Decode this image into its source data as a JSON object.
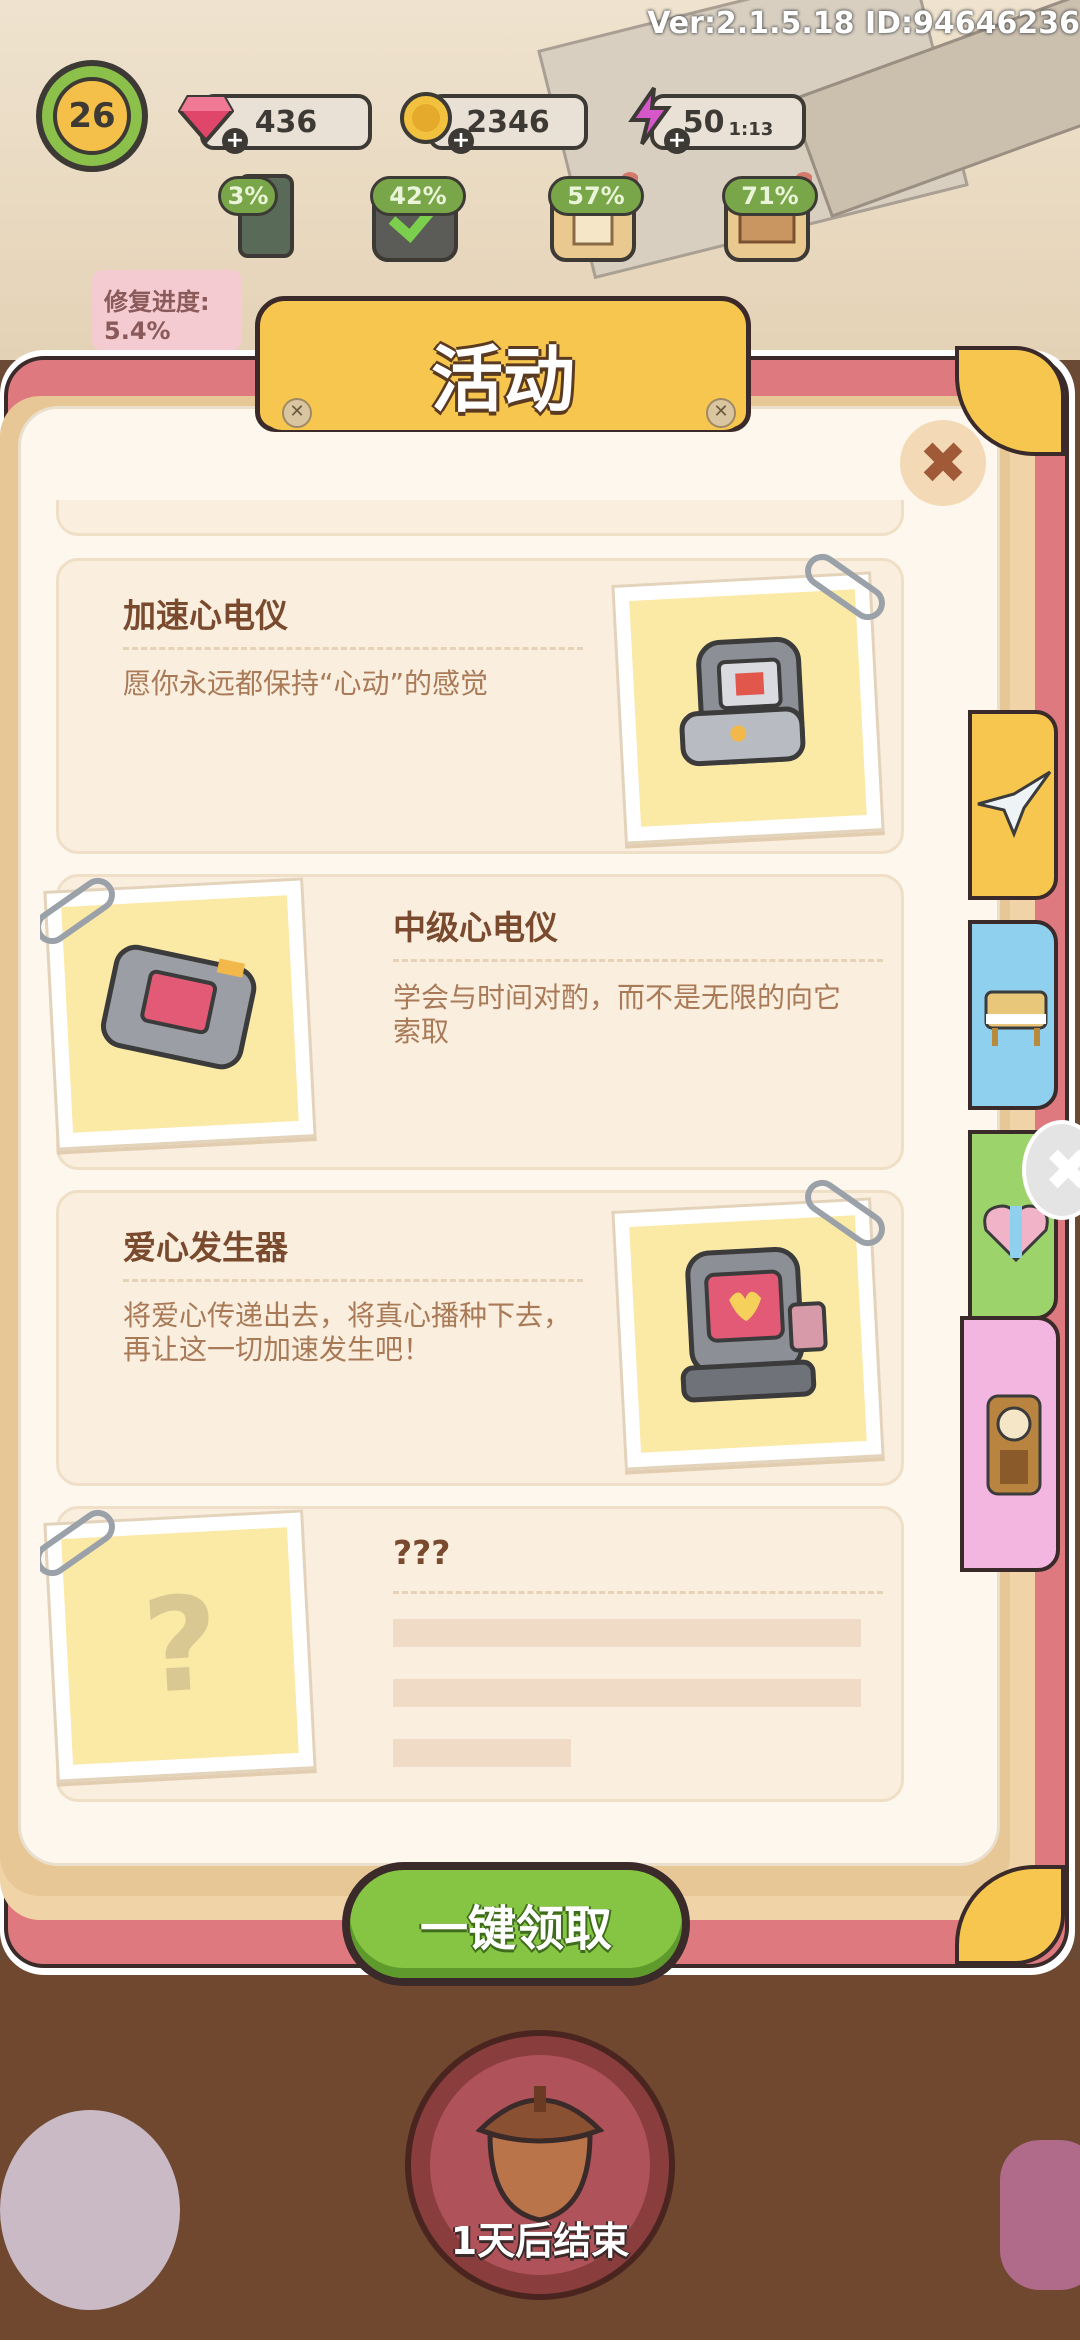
{
  "hud": {
    "version": "Ver:2.1.5.18 ID:94646236",
    "level": "26",
    "gems": "436",
    "coins": "2346",
    "energy": "50",
    "energy_timer": "1:13",
    "progress": [
      "3%",
      "42%",
      "57%",
      "71%"
    ],
    "repair_label": "修复进度:",
    "repair_value": "5.4%"
  },
  "modal": {
    "title": "活动",
    "items": [
      {
        "title": "加速心电仪",
        "desc": "愿你永远都保持“心动”的感觉",
        "icon": "ecg-machine-icon"
      },
      {
        "title": "中级心电仪",
        "desc": "学会与时间对酌，而不是无限的向它索取",
        "icon": "ecg-device-icon"
      },
      {
        "title": "爱心发生器",
        "desc": "将爱心传递出去，将真心播种下去，再让这一切加速发生吧！",
        "icon": "heart-generator-icon"
      },
      {
        "title": "???",
        "desc": "",
        "icon": "question-mark-icon",
        "placeholder_mark": "?"
      }
    ],
    "side_tabs": [
      {
        "name": "paper-crane",
        "color": "#f6c64f"
      },
      {
        "name": "piano",
        "color": "#8fd0ef"
      },
      {
        "name": "heart-box",
        "color": "#9cd36b"
      },
      {
        "name": "grandfather-clock",
        "color": "#f2b6e0"
      }
    ],
    "claim_all": "一键领取",
    "close_glyph": "✖"
  },
  "event": {
    "label": "1天后结束"
  },
  "colors": {
    "book_pink": "#de7a7f",
    "banner_yellow": "#f6c64f",
    "claim_green": "#86c443",
    "text_brown": "#7a4a2e"
  }
}
